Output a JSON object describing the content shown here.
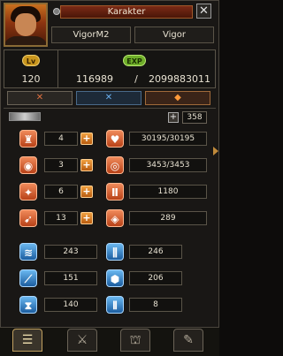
{
  "header": {
    "title": "Karakter",
    "close_glyph": "✕",
    "name": "VigorM2",
    "class": "Vigor"
  },
  "level": {
    "badge": "Lv",
    "value": "120"
  },
  "exp": {
    "badge": "EXP",
    "current": "116989",
    "separator": "/",
    "max": "2099883011"
  },
  "tabs": [
    {
      "glyph": "✕",
      "icon": "crossed-swords-icon"
    },
    {
      "glyph": "✕",
      "icon": "crossed-blades-icon"
    },
    {
      "glyph": "◆",
      "icon": "orb-icon"
    }
  ],
  "points": {
    "plus": "+",
    "value": "358"
  },
  "primary_stats": [
    {
      "icon": "strength-icon",
      "glyph": "♜",
      "value": "4"
    },
    {
      "icon": "head-icon",
      "glyph": "◉",
      "value": "3"
    },
    {
      "icon": "dexterity-icon",
      "glyph": "✦",
      "value": "6"
    },
    {
      "icon": "wing-icon",
      "glyph": "➹",
      "value": "13"
    }
  ],
  "derived_stats": [
    {
      "icon": "heart-icon",
      "glyph": "♥",
      "value": "30195/30195"
    },
    {
      "icon": "mana-icon",
      "glyph": "◎",
      "value": "3453/3453"
    },
    {
      "icon": "attack-icon",
      "glyph": "Ⅱ",
      "value": "1180"
    },
    {
      "icon": "shield-icon",
      "glyph": "◈",
      "value": "289"
    }
  ],
  "secondary_stats": [
    {
      "icon": "speed-icon",
      "glyph": "≋",
      "value": "243"
    },
    {
      "icon": "skill-attack-icon",
      "glyph": "⫼",
      "value": "246"
    },
    {
      "icon": "spear-icon",
      "glyph": "⟋",
      "value": "151"
    },
    {
      "icon": "magic-shield-icon",
      "glyph": "⬢",
      "value": "206"
    },
    {
      "icon": "hourglass-icon",
      "glyph": "⧗",
      "value": "140"
    },
    {
      "icon": "pierce-icon",
      "glyph": "⫴",
      "value": "8"
    }
  ],
  "bottom_tabs": [
    {
      "icon": "character-sheet-icon",
      "glyph": "☰"
    },
    {
      "icon": "sword-icon",
      "glyph": "⚔"
    },
    {
      "icon": "helmet-icon",
      "glyph": "⛫"
    },
    {
      "icon": "brush-icon",
      "glyph": "✎"
    }
  ],
  "colors": {
    "accent_orange": "#f0a040",
    "title_red": "#7a2a16",
    "exp_green": "#6fae2a",
    "lv_gold": "#c9961e"
  }
}
